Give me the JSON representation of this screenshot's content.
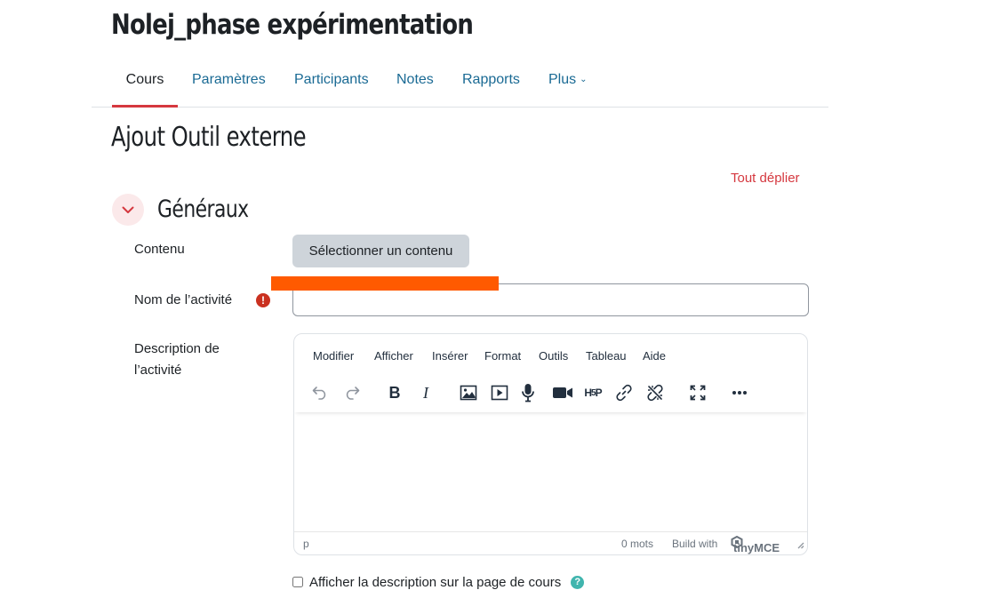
{
  "course": {
    "title": "Nolej_phase expérimentation"
  },
  "nav": {
    "tabs": [
      {
        "label": "Cours",
        "active": true
      },
      {
        "label": "Paramètres"
      },
      {
        "label": "Participants"
      },
      {
        "label": "Notes"
      },
      {
        "label": "Rapports"
      },
      {
        "label": "Plus"
      }
    ]
  },
  "page": {
    "title": "Ajout Outil externe",
    "expand_all": "Tout déplier"
  },
  "section": {
    "title": "Généraux"
  },
  "form": {
    "content_label": "Contenu",
    "content_button": "Sélectionner un contenu",
    "name_label": "Nom de l’activité",
    "name_value": "",
    "description_label": "Description de l’activité",
    "show_description_label": "Afficher la description sur la page de cours",
    "show_description_checked": false
  },
  "editor": {
    "menu": [
      "Modifier",
      "Afficher",
      "Insérer",
      "Format",
      "Outils",
      "Tableau",
      "Aide"
    ],
    "status_path": "p",
    "word_count": "0 mots",
    "branding": "Build with",
    "brand_name": "tinyMCE"
  },
  "colors": {
    "accent": "#d5383f",
    "link": "#1a6a94",
    "highlight": "#ff5a00",
    "help": "#40b5ae",
    "required": "#ca3120"
  }
}
